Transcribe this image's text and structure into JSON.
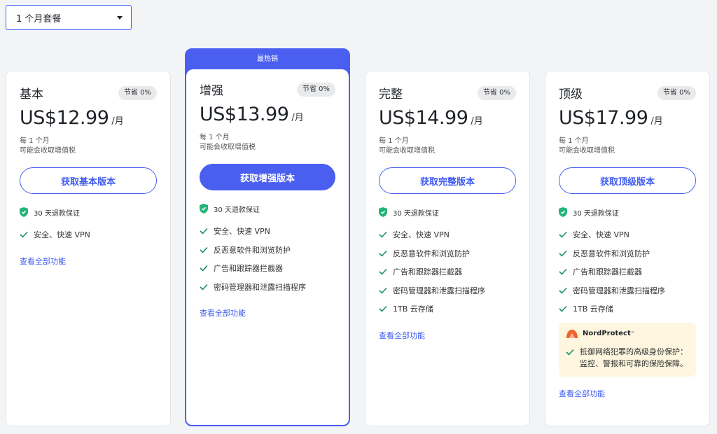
{
  "selector": {
    "value": "1 个月套餐"
  },
  "colors": {
    "accent": "#4a5ff0",
    "check": "#1a8f6a",
    "shield": "#23b37a",
    "np_bg": "#fef6df"
  },
  "plans": [
    {
      "name": "基本",
      "badge": "节省 0%",
      "amount": "US$12.99",
      "unit": "/月",
      "billing": "每 1 个月",
      "tax": "可能会收取增值税",
      "cta": "获取基本版本",
      "guarantee": "30 天退款保证",
      "features": [
        "安全、快速 VPN"
      ],
      "more": "查看全部功能"
    },
    {
      "ribbon": "最热销",
      "name": "增强",
      "badge": "节省 0%",
      "amount": "US$13.99",
      "unit": "/月",
      "billing": "每 1 个月",
      "tax": "可能会收取增值税",
      "cta": "获取增强版本",
      "guarantee": "30 天退款保证",
      "features": [
        "安全、快速 VPN",
        "反恶意软件和浏览防护",
        "广告和跟踪器拦截器",
        "密码管理器和泄露扫描程序"
      ],
      "more": "查看全部功能"
    },
    {
      "name": "完整",
      "badge": "节省 0%",
      "amount": "US$14.99",
      "unit": "/月",
      "billing": "每 1 个月",
      "tax": "可能会收取增值税",
      "cta": "获取完整版本",
      "guarantee": "30 天退款保证",
      "features": [
        "安全、快速 VPN",
        "反恶意软件和浏览防护",
        "广告和跟踪器拦截器",
        "密码管理器和泄露扫描程序",
        "1TB 云存储"
      ],
      "more": "查看全部功能"
    },
    {
      "name": "顶级",
      "badge": "节省 0%",
      "amount": "US$17.99",
      "unit": "/月",
      "billing": "每 1 个月",
      "tax": "可能会收取增值税",
      "cta": "获取顶级版本",
      "guarantee": "30 天退款保证",
      "features": [
        "安全、快速 VPN",
        "反恶意软件和浏览防护",
        "广告和跟踪器拦截器",
        "密码管理器和泄露扫描程序",
        "1TB 云存储"
      ],
      "nordprotect": {
        "brand": "NordProtect",
        "tm": "™",
        "text": "抵御网络犯罪的高级身份保护：监控、警报和可靠的保险保障。"
      },
      "more": "查看全部功能"
    }
  ]
}
